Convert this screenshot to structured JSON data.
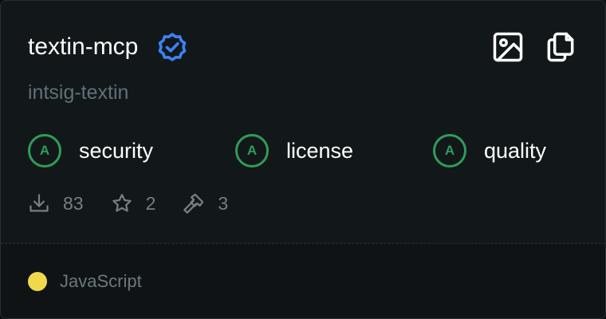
{
  "card": {
    "title": "textin-mcp",
    "organization": "intsig-textin",
    "icons": {
      "verified": "verified-badge-icon",
      "image": "image-icon",
      "copy": "copy-icon"
    },
    "grades": [
      {
        "grade": "A",
        "label": "security"
      },
      {
        "grade": "A",
        "label": "license"
      },
      {
        "grade": "A",
        "label": "quality"
      }
    ],
    "stats": {
      "downloads": "83",
      "stars": "2",
      "tools": "3"
    },
    "language": {
      "name": "JavaScript",
      "color": "#f1d84b"
    }
  },
  "colors": {
    "grade_green": "#2e9c59",
    "verified_blue": "#3b82f6",
    "background": "#121719"
  }
}
